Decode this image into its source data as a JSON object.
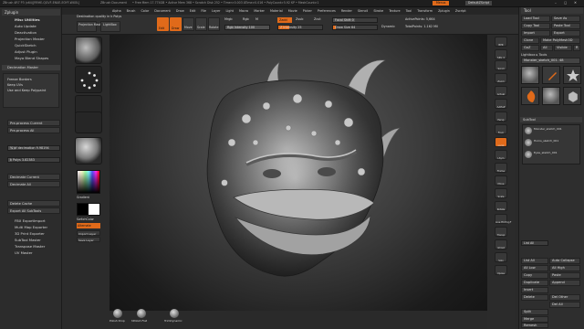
{
  "titlebar": {
    "app_info": "ZBrush 4R7 P3 (x64)[RRHE-QGVF-ENUE-EOYF-WXOL]",
    "doc_name": "ZBrush Document",
    "stats": "• Free Mem 17.774GB • Active Mem 368 • Scratch Disk 252 • Timer>0.003 ATime>0.016 • PolyCount>5.92 KP • MeshCount>1",
    "menus_label": "Menus",
    "default_script": "DefaultZScript",
    "window_controls": [
      "–",
      "▢",
      "✕"
    ]
  },
  "menubar": {
    "items": [
      "Alpha",
      "Brush",
      "Color",
      "Document",
      "Draw",
      "Edit",
      "File",
      "Layer",
      "Light",
      "Macro",
      "Marker",
      "Material",
      "Movie",
      "Picker",
      "Preferences",
      "Render",
      "Stencil",
      "Stroke",
      "Texture",
      "Tool",
      "Transform",
      "Zplugin",
      "Zscript"
    ]
  },
  "leftpanel": {
    "header": "Zplugin",
    "items_top": [
      "Misc Utilities",
      "Auto Update",
      "Deactivation",
      "Projection Master",
      "QuickSketch",
      "Adjust Plugin",
      "Maya Blend Shapes"
    ],
    "decimation_header": "Decimation Master",
    "decimation_items": [
      "Freeze Borders",
      "Keep UVs",
      "Use and Keep Polypaint"
    ],
    "preprocess_items": [
      "Pre-process Current",
      "Pre-process All"
    ],
    "percent_label": "% of decimation 9.98194",
    "kpolys_label": "k Polys 3.82383",
    "decimate_items": [
      "Decimate Current",
      "Decimate All"
    ],
    "cache_items": [
      "Delete Cache",
      "Export All SubTools"
    ],
    "bottom_items": [
      "FBX ExportImport",
      "Multi Map Exporter",
      "3D Print Exporter",
      "SubTool Master",
      "Transpose Master",
      "UV Master"
    ]
  },
  "toolshelf": {
    "dest_label": "Destination quality in k Polys",
    "projection_master": "Projection Master",
    "lightbox": "LightBox",
    "edit_label": "Edit",
    "draw_label": "Draw",
    "move_label": "Move",
    "scale_label": "Scale",
    "rotate_label": "Rotate",
    "mrgb": "Mrgb",
    "rgb": "Rgb",
    "m": "M",
    "zadd": "Zadd",
    "zsub": "Zsub",
    "zcut": "Zcut",
    "rgb_intensity": "Rgb Intensity 100",
    "z_intensity": "Z Intensity 25",
    "focal_shift": "Focal Shift 0",
    "draw_size": "Draw Size 64",
    "dynamic": "Dynamic",
    "active_points": "ActivePoints: 5,664",
    "total_points": "TotalPoints: 1.162 Mil"
  },
  "leftshelf": {
    "labels": [
      "Standard",
      "Dots",
      "AlphaOff",
      "TextureOff",
      "BasicMaterial"
    ],
    "color_labels": [
      "Gradient",
      "SwitchColor",
      "Alternate"
    ],
    "small_buttons": [
      "Import Layer",
      "Save Layer",
      "Clear All"
    ]
  },
  "rightshelf": {
    "buttons": [
      "BPR",
      "SPix 3",
      "Scroll",
      "Zoom",
      "Actual",
      "AAHalf",
      "Persp",
      "Floor",
      "Local",
      "LSym",
      "Frame",
      "Move",
      "Scale",
      "Rotate",
      "Line Fill PolyF",
      "Transp",
      "Ghost",
      "Solo",
      "Xpose"
    ]
  },
  "rightpanel": {
    "title": "Tool",
    "load_tool": "Load Tool",
    "save_as": "Save As",
    "copy_tool": "Copy Tool",
    "paste_tool": "Paste Tool",
    "import": "Import",
    "export": "Export",
    "clone": "Clone",
    "make_polymesh": "Make PolyMesh3D",
    "goz": "GoZ",
    "all": "All",
    "visible": "Visible",
    "r": "R",
    "lightbox_tools": "Lightbox ▸ Tools",
    "current_tool": "Monster_sketch_001. 48",
    "tool_thumbs": [
      "Monster_sketch",
      "SimpleBrush",
      "Star",
      "PolyMesh3D",
      "Monster_sketch",
      "Cube3D"
    ],
    "subtool_header": "SubTool",
    "subtools": [
      "Monster_sketch_001",
      "Horns_sketch_001",
      "Eyes_sketch_001"
    ],
    "list_all": "List All",
    "auto_collapse": "Auto Collapse",
    "all_low": "All Low",
    "all_high": "All High",
    "copy": "Copy",
    "paste": "Paste",
    "duplicate": "Duplicate",
    "append": "Append",
    "insert": "Insert",
    "delete": "Delete",
    "del_other": "Del Other",
    "del_all": "Del All",
    "split": "Split",
    "merge": "Merge",
    "remesh": "Remesh",
    "low_res": "Low Res"
  },
  "bottomshelf": {
    "labels": [
      "Polish Drop",
      "hPolish Flat",
      "TrimDynamic"
    ]
  },
  "colors": {
    "accent": "#e06a1a",
    "panel": "#2c2c2c",
    "sculpt_gray": "#9c9c9c"
  }
}
